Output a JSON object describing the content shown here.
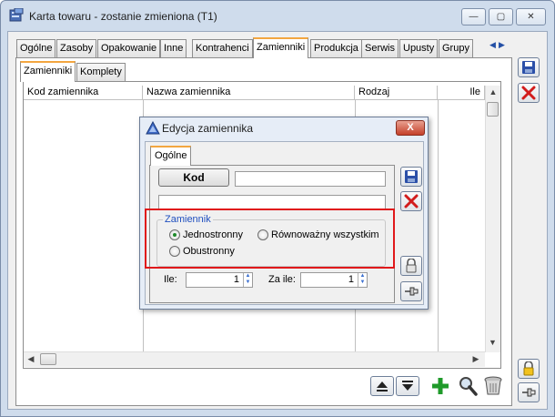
{
  "window": {
    "title": "Karta towaru - zostanie zmieniona (T1)",
    "controls": {
      "minimize": "—",
      "maximize": "▢",
      "close": "✕"
    }
  },
  "tabs": [
    "Ogólne",
    "Zasoby",
    "Opakowanie",
    "Inne",
    "Kontrahenci",
    "Zamienniki",
    "Produkcja",
    "Serwis",
    "Upusty",
    "Grupy"
  ],
  "active_tab": "Zamienniki",
  "subtabs": [
    "Zamienniki",
    "Komplety"
  ],
  "active_subtab": "Zamienniki",
  "grid": {
    "columns": [
      "Kod zamiennika",
      "Nazwa zamiennika",
      "Rodzaj",
      "Ile"
    ]
  },
  "dialog": {
    "title": "Edycja zamiennika",
    "close_label": "X",
    "tab": "Ogólne",
    "kod_button": "Kod",
    "kod_value": "",
    "name_value": "",
    "group_label": "Zamiennik",
    "options": {
      "jednostronny": "Jednostronny",
      "rownowazny": "Równoważny wszystkim",
      "obustronny": "Obustronny"
    },
    "selected": "Jednostronny",
    "ile_label": "Ile:",
    "ile_value": "1",
    "za_ile_label": "Za ile:",
    "za_ile_value": "1"
  },
  "colors": {
    "accent_tab": "#f3a640",
    "highlight_box": "#e0191b",
    "group_label": "#1f4fbf"
  }
}
